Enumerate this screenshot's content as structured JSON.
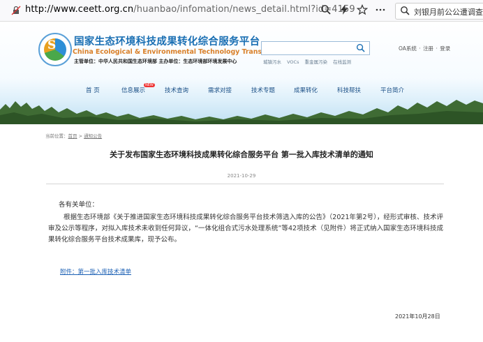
{
  "browser": {
    "url_host": "http://www.ceett.org.cn",
    "url_path": "/huanbao/infomation/news_detail.html?id=4159",
    "search_text": "刘银月前公公遭调查"
  },
  "site": {
    "title_cn": "国家生态环境科技成果转化综合服务平台",
    "title_en": "China Ecological & Environmental Technology Transformation",
    "subtitle": "主管单位：中华人民共和国生态环境部    主办单位：生态环境部环境发展中心",
    "hot_words": [
      "城镇污水",
      "VOCs",
      "重金属污染",
      "在线监测"
    ],
    "top_links": [
      "OA系统",
      "注册",
      "登录"
    ],
    "nav": [
      "首 页",
      "信息展示",
      "技术查询",
      "需求对接",
      "技术专题",
      "成果转化",
      "科技帮扶",
      "平台简介"
    ],
    "new_badge": "NEW"
  },
  "article": {
    "breadcrumb_label": "当前位置：",
    "breadcrumb": [
      "首页",
      "通知公告"
    ],
    "breadcrumb_sep": ">",
    "title": "关于发布国家生态环境科技成果转化综合服务平台 第一批入库技术清单的通知",
    "date": "2021-10-29",
    "salutation": "各有关单位：",
    "body": "根据生态环境部《关于推进国家生态环境科技成果转化综合服务平台技术筛选入库的公告》（2021年第2号），经形式审核、技术评审及公示等程序，对拟入库技术未收到任何异议，“一体化组合式污水处理系统”等42项技术（见附件）将正式纳入国家生态环境科技成果转化综合服务平台技术成果库，现予公布。",
    "attachment": "附件：第一批入库技术清单",
    "sign_date": "2021年10月28日"
  },
  "colors": {
    "brand_blue": "#1a6fb3",
    "brand_orange": "#d9802a",
    "nav_text": "#1a4f86",
    "link": "#1a5fb4"
  }
}
